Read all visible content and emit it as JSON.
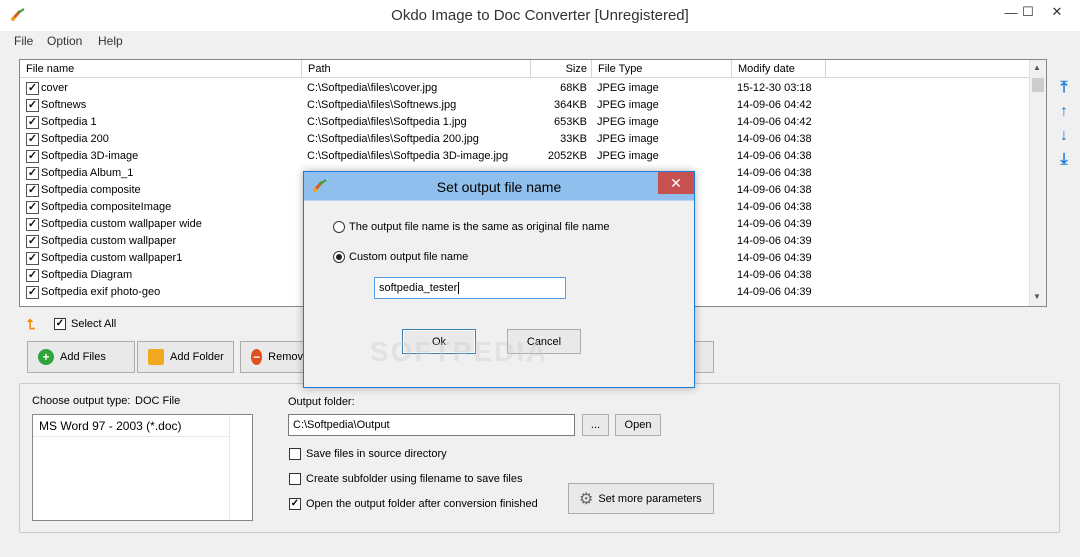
{
  "window": {
    "title": "Okdo Image to Doc Converter [Unregistered]",
    "minimize": "—",
    "maximize": "☐",
    "close": "✕"
  },
  "menu": [
    {
      "label": "File"
    },
    {
      "label": "Option"
    },
    {
      "label": "Help"
    }
  ],
  "table": {
    "columns": [
      "File name",
      "Path",
      "Size",
      "File Type",
      "Modify date"
    ],
    "rows": [
      {
        "name": "cover",
        "path": "C:\\Softpedia\\files\\cover.jpg",
        "size": "68KB",
        "type": "JPEG image",
        "date": "15-12-30 03:18",
        "checked": true
      },
      {
        "name": "Softnews",
        "path": "C:\\Softpedia\\files\\Softnews.jpg",
        "size": "364KB",
        "type": "JPEG image",
        "date": "14-09-06 04:42",
        "checked": true
      },
      {
        "name": "Softpedia 1",
        "path": "C:\\Softpedia\\files\\Softpedia 1.jpg",
        "size": "653KB",
        "type": "JPEG image",
        "date": "14-09-06 04:42",
        "checked": true
      },
      {
        "name": "Softpedia 200",
        "path": "C:\\Softpedia\\files\\Softpedia 200.jpg",
        "size": "33KB",
        "type": "JPEG image",
        "date": "14-09-06 04:38",
        "checked": true
      },
      {
        "name": "Softpedia 3D-image",
        "path": "C:\\Softpedia\\files\\Softpedia 3D-image.jpg",
        "size": "2052KB",
        "type": "JPEG image",
        "date": "14-09-06 04:38",
        "checked": true
      },
      {
        "name": "Softpedia Album_1",
        "path": "",
        "size": "",
        "type": "",
        "date": "14-09-06 04:38",
        "checked": true
      },
      {
        "name": "Softpedia composite",
        "path": "",
        "size": "",
        "type": "",
        "date": "14-09-06 04:38",
        "checked": true
      },
      {
        "name": "Softpedia compositeImage",
        "path": "",
        "size": "",
        "type": "",
        "date": "14-09-06 04:38",
        "checked": true
      },
      {
        "name": "Softpedia custom wallpaper wide",
        "path": "",
        "size": "",
        "type": "",
        "date": "14-09-06 04:39",
        "checked": true
      },
      {
        "name": "Softpedia custom wallpaper",
        "path": "",
        "size": "",
        "type": "",
        "date": "14-09-06 04:39",
        "checked": true
      },
      {
        "name": "Softpedia custom wallpaper1",
        "path": "",
        "size": "",
        "type": "",
        "date": "14-09-06 04:39",
        "checked": true
      },
      {
        "name": "Softpedia Diagram",
        "path": "",
        "size": "",
        "type": "",
        "date": "14-09-06 04:38",
        "checked": true
      },
      {
        "name": "Softpedia exif photo-geo",
        "path": "",
        "size": "",
        "type": "",
        "date": "14-09-06 04:39",
        "checked": true
      }
    ]
  },
  "toolbar": {
    "select_all": "Select All",
    "add_files": "Add Files",
    "add_folder": "Add Folder",
    "remove": "Remov"
  },
  "output": {
    "type_label": "Choose output type:",
    "type_value": "DOC File",
    "formats": [
      "MS Word 97 - 2003 (*.doc)"
    ],
    "folder_label": "Output folder:",
    "folder_value": "C:\\Softpedia\\Output",
    "browse": "...",
    "open": "Open",
    "opt_source": "Save files in source directory",
    "opt_subfolder": "Create subfolder using filename to save files",
    "opt_open": "Open the output folder after conversion finished",
    "opt_source_checked": false,
    "opt_subfolder_checked": false,
    "opt_open_checked": true,
    "set_params": "Set more parameters"
  },
  "dialog": {
    "title": "Set output file name",
    "close": "✕",
    "option_same": "The output file name is the same as original file name",
    "option_custom": "Custom output file name",
    "selected": "custom",
    "custom_value": "softpedia_tester",
    "ok": "Ok",
    "cancel": "Cancel"
  },
  "watermark": "SOFTPEDIA"
}
